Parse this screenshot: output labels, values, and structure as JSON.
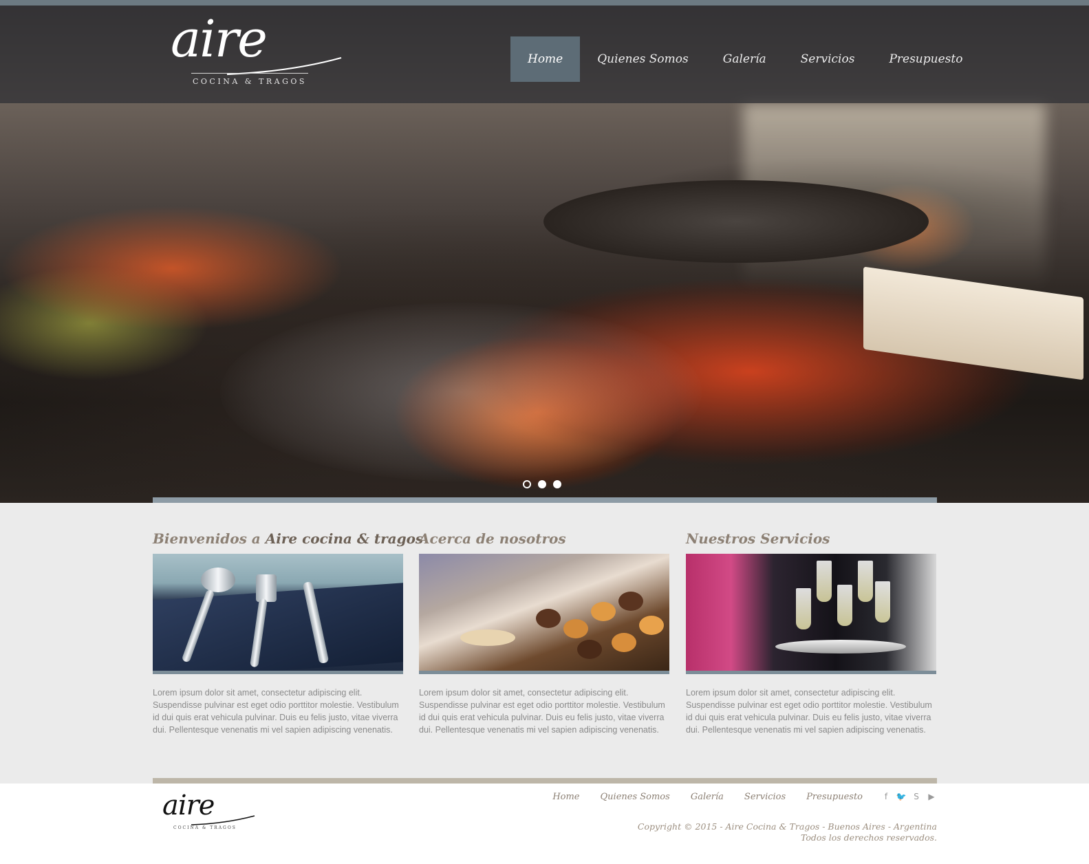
{
  "header": {
    "logo": {
      "word": "aire",
      "tagline": "COCINA & TRAGOS"
    },
    "nav": [
      {
        "label": "Home",
        "active": true
      },
      {
        "label": "Quienes Somos",
        "active": false
      },
      {
        "label": "Galería",
        "active": false
      },
      {
        "label": "Servicios",
        "active": false
      },
      {
        "label": "Presupuesto",
        "active": false
      }
    ]
  },
  "slider": {
    "slides": 3,
    "current": 1
  },
  "sections": [
    {
      "title_prefix": "Bienvenidos a ",
      "title_bold": "Aire cocina & tragos",
      "image": "cutlery-photo",
      "text": "Lorem ipsum dolor sit amet, consectetur adipiscing elit. Suspendisse pulvinar est eget odio porttitor molestie. Vestibulum id dui quis erat vehicula pulvinar. Duis eu felis justo, vitae viverra dui. Pellentesque venenatis mi vel sapien adipiscing venenatis."
    },
    {
      "title_prefix": "Acerca de nosotros",
      "title_bold": "",
      "image": "pastries-photo",
      "text": "Lorem ipsum dolor sit amet, consectetur adipiscing elit. Suspendisse pulvinar est eget odio porttitor molestie. Vestibulum id dui quis erat vehicula pulvinar. Duis eu felis justo, vitae viverra dui. Pellentesque venenatis mi vel sapien adipiscing venenatis."
    },
    {
      "title_prefix": "Nuestros Servicios",
      "title_bold": "",
      "image": "champagne-photo",
      "text": "Lorem ipsum dolor sit amet, consectetur adipiscing elit. Suspendisse pulvinar est eget odio porttitor molestie. Vestibulum id dui quis erat vehicula pulvinar. Duis eu felis justo, vitae viverra dui. Pellentesque venenatis mi vel sapien adipiscing venenatis."
    }
  ],
  "footer": {
    "logo": {
      "word": "aire",
      "tagline": "COCINA & TRAGOS"
    },
    "nav": [
      "Home",
      "Quienes Somos",
      "Galería",
      "Servicios",
      "Presupuesto"
    ],
    "social": [
      {
        "icon": "facebook-icon",
        "glyph": "f"
      },
      {
        "icon": "twitter-icon",
        "glyph": "🐦"
      },
      {
        "icon": "skype-icon",
        "glyph": "S"
      },
      {
        "icon": "youtube-icon",
        "glyph": "▶"
      }
    ],
    "copyright_line1": "Copyright © 2015 - Aire Cocina & Tragos - Buenos Aires - Argentina",
    "copyright_line2": "Todos los derechos reservados."
  },
  "colors": {
    "nav_active_bg": "#5d6c76",
    "accent_bar": "#8d9ba5",
    "footer_bar": "#bdb6a8",
    "title_text": "#8c8074"
  }
}
